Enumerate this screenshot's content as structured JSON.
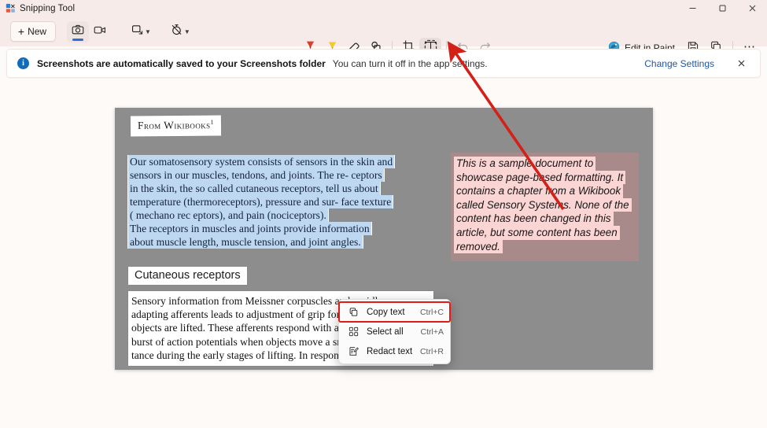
{
  "window": {
    "title": "Snipping Tool",
    "app_icon": "snipping-tool-icon",
    "controls": {
      "minimize": "minimize-icon",
      "maximize": "maximize-icon",
      "close": "close-icon"
    }
  },
  "toolbar": {
    "new_label": "New",
    "new_plus": "+",
    "mode_buttons": [
      {
        "name": "snip-mode-button",
        "icon": "camera-icon",
        "selected": true
      },
      {
        "name": "record-mode-button",
        "icon": "video-camera-icon",
        "selected": false
      }
    ],
    "shape_dropdown": {
      "icon": "rectangle-shape-icon",
      "caret": "chevron-down-icon"
    },
    "delay_dropdown": {
      "icon": "timer-off-icon",
      "caret": "chevron-down-icon"
    },
    "tools": [
      {
        "name": "ballpoint-pen-tool",
        "icon": "ballpoint-pen-icon",
        "selected": false,
        "caret": true
      },
      {
        "name": "highlighter-tool",
        "icon": "highlighter-icon",
        "selected": false
      },
      {
        "name": "eraser-tool",
        "icon": "eraser-icon",
        "selected": false
      },
      {
        "name": "shapes-tool",
        "icon": "shapes-icon",
        "selected": false
      },
      {
        "name": "crop-tool",
        "icon": "crop-icon",
        "selected": false
      },
      {
        "name": "text-actions-tool",
        "icon": "text-actions-icon",
        "selected": true
      },
      {
        "name": "undo-button",
        "icon": "undo-icon",
        "disabled": true
      },
      {
        "name": "redo-button",
        "icon": "redo-icon",
        "disabled": true
      }
    ],
    "edit_in_paint_label": "Edit in Paint",
    "edit_in_paint_icon": "paint-palette-icon",
    "save_icon": "save-disk-icon",
    "copy_icon": "copy-icon",
    "more_label": "⋯"
  },
  "notification": {
    "icon": "info-icon",
    "badge": "i",
    "strong_text": "Screenshots are automatically saved to your Screenshots folder",
    "sub_text": "You can turn it off in the app settings.",
    "link_label": "Change Settings",
    "close_icon": "close-icon"
  },
  "snip": {
    "doc_header": "From Wikibooks",
    "doc_header_superscript": "1",
    "selected_paragraph_lines": [
      "Our somatosensory system consists of  sensors in the skin  and",
      "sensors in our  muscles, tendons, and  joints. The re- ceptors",
      "in the skin, the so  called cutaneous receptors,  tell  us about",
      "temperature (thermoreceptors),  pressure and sur-  face  texture",
      "(  mechano  rec  eptors),  and  pain  (nociceptors).",
      "The  receptors  in  muscles  and  joints  provide  information",
      "about muscle length, muscle   tension, and  joint angles."
    ],
    "section_heading": "Cutaneous receptors",
    "body_lines": [
      "Sensory information from Meissner corpuscles and rapidly",
      "adapting afferents leads to adjustment of grip force when",
      "objects are  lifted.  These  afferents  respond  with  a  brief",
      "burst of action potentials when objects move a small dis-",
      "tance  during  the  early  stages  of lifting.  In  response  to"
    ],
    "callout_lines": [
      "This is a sample document to",
      "showcase page-based formatting. It",
      "contains a chapter from a Wikibook",
      "called Sensory Systems. None of the",
      "content has been changed in this",
      "article, but some content has been",
      "removed."
    ]
  },
  "context_menu": {
    "items": [
      {
        "label": "Copy text",
        "shortcut": "Ctrl+C",
        "icon": "copy-icon",
        "focused": true
      },
      {
        "label": "Select all",
        "shortcut": "Ctrl+A",
        "icon": "select-all-icon",
        "focused": false
      },
      {
        "label": "Redact text",
        "shortcut": "Ctrl+R",
        "icon": "redact-icon",
        "focused": false
      }
    ]
  },
  "annotation": {
    "arrow_color": "#d32018",
    "highlight_box_color": "#e01b18"
  },
  "colors": {
    "titlebar_bg": "#f6ebe8",
    "page_bg": "#fdfaf8",
    "snip_bg": "#8d8d8d",
    "selection_blue": "#bdd8f0",
    "callout_pink": "#fbd4d4",
    "callout_backdrop": "#a98a8a",
    "link_blue": "#2255a4"
  }
}
